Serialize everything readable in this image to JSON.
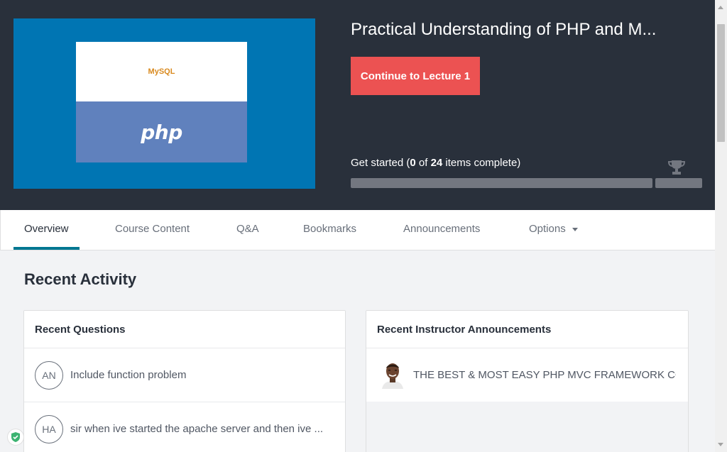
{
  "course": {
    "title": "Practical Understanding of PHP and M...",
    "continue_label": "Continue to Lecture 1",
    "thumbnail": {
      "logo_top": "MySQL",
      "logo_bottom": "php"
    }
  },
  "progress": {
    "prefix": "Get started (",
    "completed": "0",
    "of_label": " of ",
    "total": "24",
    "suffix": " items complete)",
    "fraction": 0
  },
  "tabs": [
    {
      "label": "Overview",
      "active": true
    },
    {
      "label": "Course Content",
      "active": false
    },
    {
      "label": "Q&A",
      "active": false
    },
    {
      "label": "Bookmarks",
      "active": false
    },
    {
      "label": "Announcements",
      "active": false
    },
    {
      "label": "Options",
      "active": false
    }
  ],
  "recent_activity": {
    "title": "Recent Activity",
    "questions": {
      "title": "Recent Questions",
      "items": [
        {
          "initials": "AN",
          "text": "Include function problem"
        },
        {
          "initials": "HA",
          "text": "sir when ive started the apache server and then ive ..."
        }
      ]
    },
    "announcements": {
      "title": "Recent Instructor Announcements",
      "items": [
        {
          "text": "THE BEST & MOST EASY PHP MVC FRAMEWORK CO..."
        }
      ]
    }
  },
  "colors": {
    "hero_bg": "#29303b",
    "accent": "#ec5252",
    "tab_active": "#007791",
    "thumb_bg": "#0075b3"
  },
  "icons": [
    "trophy-icon",
    "chevron-down-icon",
    "shield-icon",
    "mysql-logo",
    "php-logo"
  ]
}
